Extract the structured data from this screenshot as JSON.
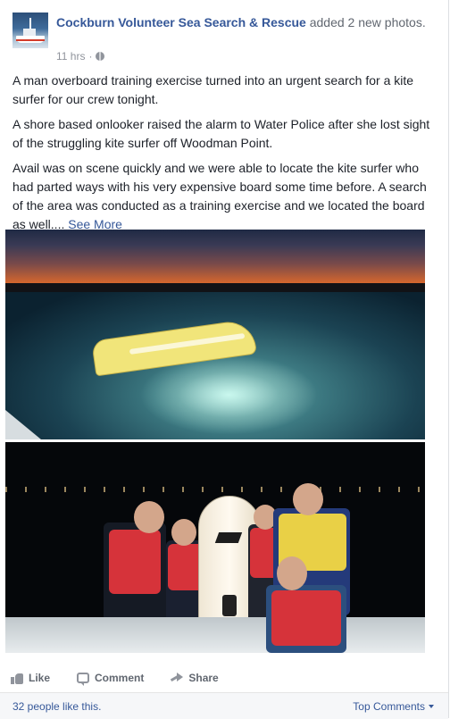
{
  "post": {
    "page_name": "Cockburn Volunteer Sea Search & Rescue",
    "action_text": "added 2 new photos.",
    "timestamp": "11 hrs",
    "separator": "·",
    "paragraphs": [
      "A man overboard training exercise turned into an urgent search for a kite surfer for our crew tonight.",
      "A shore based onlooker raised the alarm to Water Police after she lost sight of the struggling kite surfer off Woodman Point.",
      "Avail was on scene quickly and we were able to locate the kite surfer who had parted ways with his very expensive board some time before. A search of the area was conducted as a training exercise and we located the board as well...."
    ],
    "see_more": "See More"
  },
  "actions": {
    "like": "Like",
    "comment": "Comment",
    "share": "Share"
  },
  "footer": {
    "likes": "32 people like this.",
    "top_comments": "Top Comments"
  },
  "icons": {
    "avatar": "boat-avatar",
    "privacy": "globe-icon",
    "like": "thumbs-up-icon",
    "comment": "speech-bubble-icon",
    "share": "share-arrow-icon",
    "caret": "caret-down-icon"
  },
  "colors": {
    "link": "#365899",
    "secondary_text": "#90949c",
    "action_text": "#616770"
  }
}
